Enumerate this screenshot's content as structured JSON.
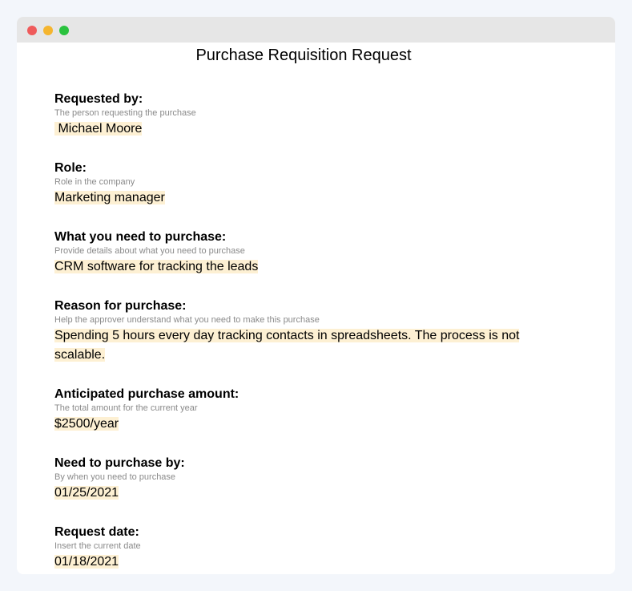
{
  "window": {
    "controls": [
      "close",
      "minimize",
      "maximize"
    ]
  },
  "document": {
    "title": "Purchase Requisition Request",
    "highlight_color": "#fdf0d3",
    "fields": [
      {
        "label": "Requested by:",
        "hint": "The person requesting the purchase",
        "value": " Michael Moore"
      },
      {
        "label": "Role:",
        "hint": "Role in the company",
        "value": "Marketing manager"
      },
      {
        "label": "What you need to purchase:",
        "hint": "Provide details about what you need to purchase",
        "value": "CRM software for tracking the leads"
      },
      {
        "label": "Reason for purchase:",
        "hint": "Help the approver understand what you need to make this purchase",
        "value": "Spending 5 hours every day tracking contacts in spreadsheets. The process is not scalable."
      },
      {
        "label": "Anticipated purchase amount:",
        "hint": "The total amount for the current year",
        "value": "$2500/year"
      },
      {
        "label": "Need to purchase by:",
        "hint": "By when you need to purchase",
        "value": "01/25/2021"
      },
      {
        "label": "Request date:",
        "hint": "Insert the current date",
        "value": "01/18/2021"
      }
    ]
  }
}
